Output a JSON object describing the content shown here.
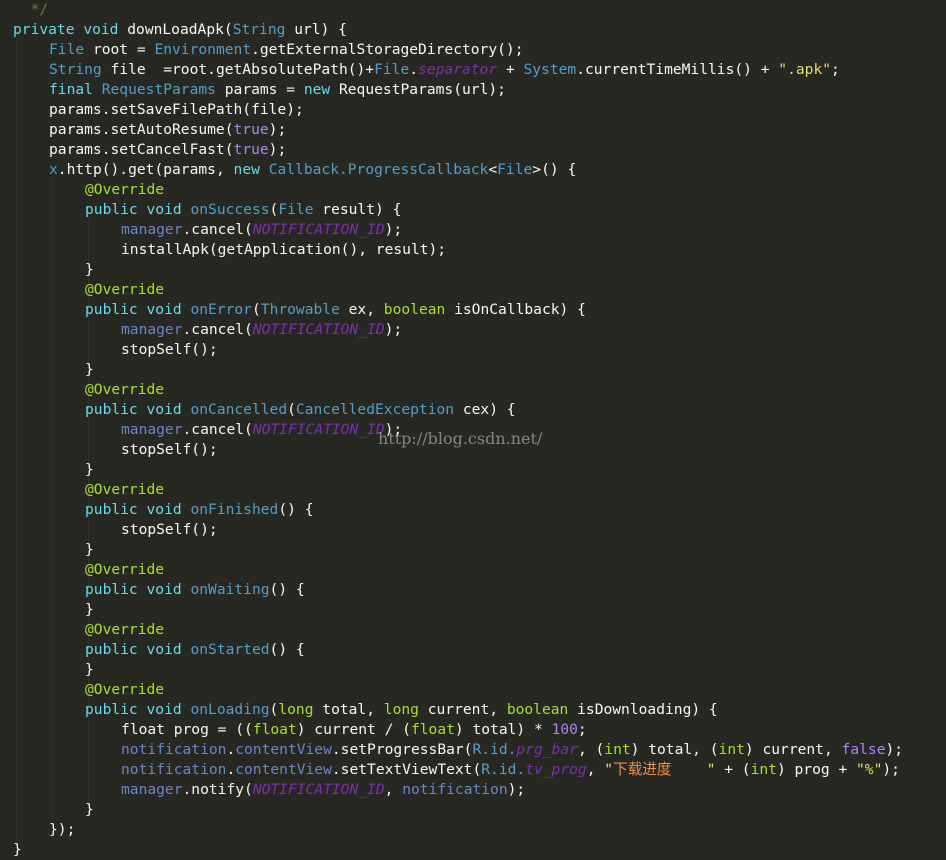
{
  "editor": {
    "theme_colors": {
      "background": "#272822",
      "text": "#f8f8f2",
      "keyword": "#66d9ef",
      "string": "#e6db74",
      "annotation": "#a6e22e",
      "literal": "#ae81ff",
      "constant": "#7b2fb0",
      "comment": "#75715e"
    },
    "watermark": "http://blog.csdn.net/",
    "lines": [
      {
        "indent": 0,
        "tokens": [
          [
            "cmt",
            "  */"
          ]
        ]
      },
      {
        "indent": 0,
        "tokens": [
          [
            "kw",
            "private"
          ],
          [
            "p",
            " "
          ],
          [
            "kw",
            "void"
          ],
          [
            "p",
            " downLoadApk("
          ],
          [
            "cls",
            "String"
          ],
          [
            "p",
            " url) {"
          ]
        ]
      },
      {
        "indent": 1,
        "tokens": [
          [
            "cls",
            "File"
          ],
          [
            "p",
            " root = "
          ],
          [
            "cls",
            "Environment"
          ],
          [
            "p",
            ".getExternalStorageDirectory();"
          ]
        ]
      },
      {
        "indent": 1,
        "tokens": [
          [
            "cls",
            "String"
          ],
          [
            "p",
            " file  =root.getAbsolutePath()+"
          ],
          [
            "cls",
            "File"
          ],
          [
            "p",
            "."
          ],
          [
            "const",
            "separator"
          ],
          [
            "p",
            " + "
          ],
          [
            "cls",
            "System"
          ],
          [
            "p",
            ".currentTimeMillis() + "
          ],
          [
            "str",
            "\".apk\""
          ],
          [
            "p",
            ";"
          ]
        ]
      },
      {
        "indent": 1,
        "tokens": [
          [
            "kw",
            "final"
          ],
          [
            "p",
            " "
          ],
          [
            "cls",
            "RequestParams"
          ],
          [
            "p",
            " params = "
          ],
          [
            "kw",
            "new"
          ],
          [
            "p",
            " RequestParams(url);"
          ]
        ]
      },
      {
        "indent": 1,
        "tokens": [
          [
            "p",
            "params.setSaveFilePath(file);"
          ]
        ]
      },
      {
        "indent": 1,
        "tokens": [
          [
            "p",
            "params.setAutoResume("
          ],
          [
            "lit",
            "true"
          ],
          [
            "p",
            ");"
          ]
        ]
      },
      {
        "indent": 1,
        "tokens": [
          [
            "p",
            "params.setCancelFast("
          ],
          [
            "lit",
            "true"
          ],
          [
            "p",
            ");"
          ]
        ]
      },
      {
        "indent": 1,
        "tokens": [
          [
            "cls",
            "x"
          ],
          [
            "p",
            ".http().get(params, "
          ],
          [
            "kw",
            "new"
          ],
          [
            "p",
            " "
          ],
          [
            "cls",
            "Callback.ProgressCallback"
          ],
          [
            "p",
            "<"
          ],
          [
            "cls",
            "File"
          ],
          [
            "p",
            ">() {"
          ]
        ]
      },
      {
        "indent": 2,
        "tokens": [
          [
            "ann",
            "@Override"
          ]
        ]
      },
      {
        "indent": 2,
        "tokens": [
          [
            "kw",
            "public"
          ],
          [
            "p",
            " "
          ],
          [
            "kw",
            "void"
          ],
          [
            "p",
            " "
          ],
          [
            "lnk",
            "onSuccess"
          ],
          [
            "p",
            "("
          ],
          [
            "cls",
            "File"
          ],
          [
            "p",
            " result) {"
          ]
        ]
      },
      {
        "indent": 3,
        "tokens": [
          [
            "fld",
            "manager"
          ],
          [
            "p",
            ".cancel("
          ],
          [
            "const",
            "NOTIFICATION_ID"
          ],
          [
            "p",
            ");"
          ]
        ]
      },
      {
        "indent": 3,
        "tokens": [
          [
            "p",
            "installApk(getApplication(), result);"
          ]
        ]
      },
      {
        "indent": 2,
        "tokens": [
          [
            "p",
            "}"
          ]
        ]
      },
      {
        "indent": 2,
        "tokens": [
          [
            "ann",
            "@Override"
          ]
        ]
      },
      {
        "indent": 2,
        "tokens": [
          [
            "kw",
            "public"
          ],
          [
            "p",
            " "
          ],
          [
            "kw",
            "void"
          ],
          [
            "p",
            " "
          ],
          [
            "lnk",
            "onError"
          ],
          [
            "p",
            "("
          ],
          [
            "cls",
            "Throwable"
          ],
          [
            "p",
            " ex, "
          ],
          [
            "ann",
            "boolean"
          ],
          [
            "p",
            " isOnCallback) {"
          ]
        ]
      },
      {
        "indent": 3,
        "tokens": [
          [
            "fld",
            "manager"
          ],
          [
            "p",
            ".cancel("
          ],
          [
            "const",
            "NOTIFICATION_ID"
          ],
          [
            "p",
            ");"
          ]
        ]
      },
      {
        "indent": 3,
        "tokens": [
          [
            "p",
            "stopSelf();"
          ]
        ]
      },
      {
        "indent": 2,
        "tokens": [
          [
            "p",
            "}"
          ]
        ]
      },
      {
        "indent": 2,
        "tokens": [
          [
            "ann",
            "@Override"
          ]
        ]
      },
      {
        "indent": 2,
        "tokens": [
          [
            "kw",
            "public"
          ],
          [
            "p",
            " "
          ],
          [
            "kw",
            "void"
          ],
          [
            "p",
            " "
          ],
          [
            "lnk",
            "onCancelled"
          ],
          [
            "p",
            "("
          ],
          [
            "cls",
            "CancelledException"
          ],
          [
            "p",
            " cex) {"
          ]
        ]
      },
      {
        "indent": 3,
        "tokens": [
          [
            "fld",
            "manager"
          ],
          [
            "p",
            ".cancel("
          ],
          [
            "const",
            "NOTIFICATION_ID"
          ],
          [
            "p",
            ");"
          ]
        ]
      },
      {
        "indent": 3,
        "tokens": [
          [
            "p",
            "stopSelf();"
          ]
        ]
      },
      {
        "indent": 2,
        "tokens": [
          [
            "p",
            "}"
          ]
        ]
      },
      {
        "indent": 2,
        "tokens": [
          [
            "ann",
            "@Override"
          ]
        ]
      },
      {
        "indent": 2,
        "tokens": [
          [
            "kw",
            "public"
          ],
          [
            "p",
            " "
          ],
          [
            "kw",
            "void"
          ],
          [
            "p",
            " "
          ],
          [
            "lnk",
            "onFinished"
          ],
          [
            "p",
            "() {"
          ]
        ]
      },
      {
        "indent": 3,
        "tokens": [
          [
            "p",
            "stopSelf();"
          ]
        ]
      },
      {
        "indent": 2,
        "tokens": [
          [
            "p",
            "}"
          ]
        ]
      },
      {
        "indent": 2,
        "tokens": [
          [
            "ann",
            "@Override"
          ]
        ]
      },
      {
        "indent": 2,
        "tokens": [
          [
            "kw",
            "public"
          ],
          [
            "p",
            " "
          ],
          [
            "kw",
            "void"
          ],
          [
            "p",
            " "
          ],
          [
            "lnk",
            "onWaiting"
          ],
          [
            "p",
            "() {"
          ]
        ]
      },
      {
        "indent": 2,
        "tokens": [
          [
            "p",
            "}"
          ]
        ]
      },
      {
        "indent": 2,
        "tokens": [
          [
            "ann",
            "@Override"
          ]
        ]
      },
      {
        "indent": 2,
        "tokens": [
          [
            "kw",
            "public"
          ],
          [
            "p",
            " "
          ],
          [
            "kw",
            "void"
          ],
          [
            "p",
            " "
          ],
          [
            "lnk",
            "onStarted"
          ],
          [
            "p",
            "() {"
          ]
        ]
      },
      {
        "indent": 2,
        "tokens": [
          [
            "p",
            "}"
          ]
        ]
      },
      {
        "indent": 2,
        "tokens": [
          [
            "ann",
            "@Override"
          ]
        ]
      },
      {
        "indent": 2,
        "tokens": [
          [
            "kw",
            "public"
          ],
          [
            "p",
            " "
          ],
          [
            "kw",
            "void"
          ],
          [
            "p",
            " "
          ],
          [
            "lnk",
            "onLoading"
          ],
          [
            "p",
            "("
          ],
          [
            "ann",
            "long"
          ],
          [
            "p",
            " total, "
          ],
          [
            "ann",
            "long"
          ],
          [
            "p",
            " current, "
          ],
          [
            "ann",
            "boolean"
          ],
          [
            "p",
            " isDownloading) {"
          ]
        ]
      },
      {
        "indent": 3,
        "tokens": [
          [
            "p",
            "float prog = (("
          ],
          [
            "ann",
            "float"
          ],
          [
            "p",
            ") current / ("
          ],
          [
            "ann",
            "float"
          ],
          [
            "p",
            ") total) * "
          ],
          [
            "num",
            "100"
          ],
          [
            "p",
            ";"
          ]
        ]
      },
      {
        "indent": 3,
        "tokens": [
          [
            "fld",
            "notification"
          ],
          [
            "p",
            "."
          ],
          [
            "fld",
            "contentView"
          ],
          [
            "p",
            ".setProgressBar("
          ],
          [
            "cls",
            "R.id."
          ],
          [
            "const",
            "prg_bar"
          ],
          [
            "p",
            ", ("
          ],
          [
            "ann",
            "int"
          ],
          [
            "p",
            ") total, ("
          ],
          [
            "ann",
            "int"
          ],
          [
            "p",
            ") current, "
          ],
          [
            "lit",
            "false"
          ],
          [
            "p",
            ");"
          ]
        ]
      },
      {
        "indent": 3,
        "tokens": [
          [
            "fld",
            "notification"
          ],
          [
            "p",
            "."
          ],
          [
            "fld",
            "contentView"
          ],
          [
            "p",
            ".setTextViewText("
          ],
          [
            "cls",
            "R.id."
          ],
          [
            "const",
            "tv_prog"
          ],
          [
            "p",
            ", "
          ],
          [
            "str",
            "\""
          ],
          [
            "cn",
            "下载进度    "
          ],
          [
            "str",
            "\""
          ],
          [
            "p",
            " + ("
          ],
          [
            "ann",
            "int"
          ],
          [
            "p",
            ") prog + "
          ],
          [
            "str",
            "\"%\""
          ],
          [
            "p",
            ");"
          ]
        ]
      },
      {
        "indent": 3,
        "tokens": [
          [
            "fld",
            "manager"
          ],
          [
            "p",
            ".notify("
          ],
          [
            "const",
            "NOTIFICATION_ID"
          ],
          [
            "p",
            ", "
          ],
          [
            "fld",
            "notification"
          ],
          [
            "p",
            ");"
          ]
        ]
      },
      {
        "indent": 2,
        "tokens": [
          [
            "p",
            "}"
          ]
        ]
      },
      {
        "indent": 1,
        "tokens": [
          [
            "p",
            "});"
          ]
        ]
      },
      {
        "indent": 0,
        "tokens": [
          [
            "p",
            "}"
          ]
        ]
      }
    ]
  }
}
